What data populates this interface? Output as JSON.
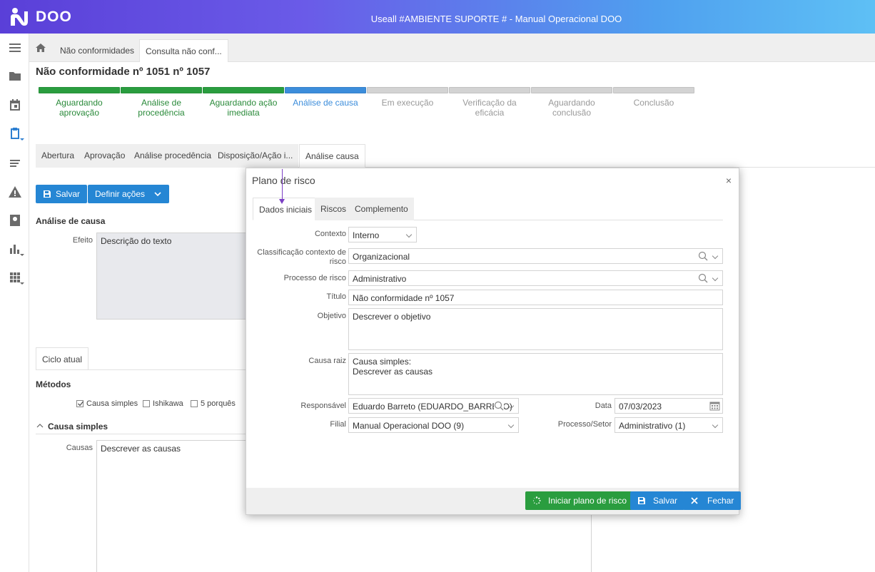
{
  "header": {
    "logo_text": "DOO",
    "title": "Useall #AMBIENTE SUPORTE # - Manual Operacional DOO"
  },
  "rail": {
    "icons": [
      "menu-icon",
      "folder-icon",
      "calendar-icon",
      "clipboard-icon",
      "list-icon",
      "warning-icon",
      "contact-icon",
      "bar-chart-icon",
      "apps-grid-icon"
    ]
  },
  "breadcrumb": {
    "items": [
      "Não conformidades",
      "Consulta não conf..."
    ]
  },
  "page": {
    "title": "Não conformidade nº 1051 nº 1057"
  },
  "steps": [
    {
      "label": "Aguardando aprovação",
      "state": "done"
    },
    {
      "label": "Análise de procedência",
      "state": "done"
    },
    {
      "label": "Aguardando ação imediata",
      "state": "done"
    },
    {
      "label": "Análise de causa",
      "state": "current"
    },
    {
      "label": "Em execução",
      "state": "todo"
    },
    {
      "label": "Verificação da eficácia",
      "state": "todo"
    },
    {
      "label": "Aguardando conclusão",
      "state": "todo"
    },
    {
      "label": "Conclusão",
      "state": "todo"
    }
  ],
  "colors": {
    "done": "#2a9d3f",
    "current": "#3c8ddb",
    "todo": "#d3d3d3",
    "done_text": "#2a8a3a",
    "current_text": "#3c8ddb",
    "todo_text": "#999999"
  },
  "subtabs": [
    "Abertura",
    "Aprovação",
    "Análise procedência",
    "Disposição/Ação i...",
    "Análise causa"
  ],
  "actions": {
    "save": "Salvar",
    "define": "Definir ações"
  },
  "analysis": {
    "section": "Análise de causa",
    "effect_label": "Efeito",
    "effect_value": "Descrição do texto",
    "cycle_tab": "Ciclo atual",
    "methods_label": "Métodos",
    "methods": [
      {
        "label": "Causa simples",
        "checked": true
      },
      {
        "label": "Ishikawa",
        "checked": false
      },
      {
        "label": "5 porquês",
        "checked": false
      }
    ],
    "simple_section": "Causa simples",
    "causes_label": "Causas",
    "causes_value": "Descrever as causas"
  },
  "modal": {
    "title": "Plano de risco",
    "close": "×",
    "tabs": [
      "Dados iniciais",
      "Riscos",
      "Complemento"
    ],
    "fields": {
      "contexto": {
        "label": "Contexto",
        "value": "Interno"
      },
      "classificacao": {
        "label": "Classificação contexto de risco",
        "value": "Organizacional"
      },
      "processo": {
        "label": "Processo de risco",
        "value": "Administrativo"
      },
      "titulo": {
        "label": "Título",
        "value": "Não conformidade nº 1057"
      },
      "objetivo": {
        "label": "Objetivo",
        "value": "Descrever o objetivo"
      },
      "causa_raiz": {
        "label": "Causa raiz",
        "value": "Causa simples:\nDescrever as causas"
      },
      "responsavel": {
        "label": "Responsável",
        "value": "Eduardo Barreto  (EDUARDO_BARRETO)"
      },
      "data": {
        "label": "Data",
        "value": "07/03/2023"
      },
      "filial": {
        "label": "Filial",
        "value": "Manual Operacional DOO (9)"
      },
      "processo_setor": {
        "label": "Processo/Setor",
        "value": "Administrativo (1)"
      }
    },
    "buttons": {
      "start": "Iniciar plano de risco",
      "save": "Salvar",
      "close": "Fechar"
    }
  }
}
